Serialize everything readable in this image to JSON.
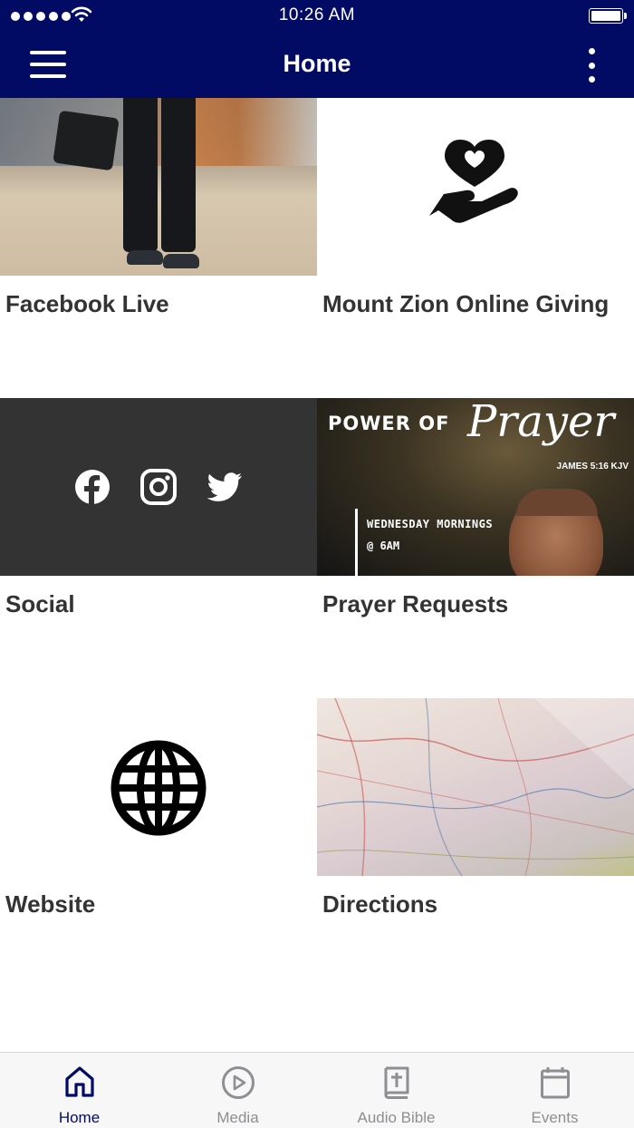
{
  "status_bar": {
    "time": "10:26 AM"
  },
  "nav": {
    "title": "Home",
    "menu_icon": "hamburger-menu-icon",
    "more_icon": "vertical-ellipsis-icon"
  },
  "colors": {
    "nav_background": "#020b64",
    "tab_active": "#020b64",
    "tab_inactive": "#8e8e93",
    "label_text": "#333333",
    "social_tile_background": "#333333"
  },
  "tiles": [
    {
      "label": "Facebook Live",
      "image": "photo-person-on-beach-with-camera"
    },
    {
      "label": "Mount Zion Online Giving",
      "icon": "heart-in-hand-icon"
    },
    {
      "label": "Social",
      "icons": [
        "facebook-icon",
        "instagram-icon",
        "twitter-icon"
      ]
    },
    {
      "label": "Prayer Requests",
      "image": "prayer-banner",
      "banner": {
        "title": "POWER OF",
        "script": "Prayer",
        "reference": "JAMES 5:16 KJV",
        "day": "WEDNESDAY MORNINGS",
        "time": "@ 6AM"
      }
    },
    {
      "label": "Website",
      "icon": "globe-icon"
    },
    {
      "label": "Directions",
      "image": "photo-road-map"
    }
  ],
  "tabbar": {
    "items": [
      {
        "label": "Home",
        "icon": "home-icon",
        "active": true
      },
      {
        "label": "Media",
        "icon": "play-circle-icon",
        "active": false
      },
      {
        "label": "Audio Bible",
        "icon": "bible-icon",
        "active": false
      },
      {
        "label": "Events",
        "icon": "calendar-icon",
        "active": false
      }
    ]
  }
}
